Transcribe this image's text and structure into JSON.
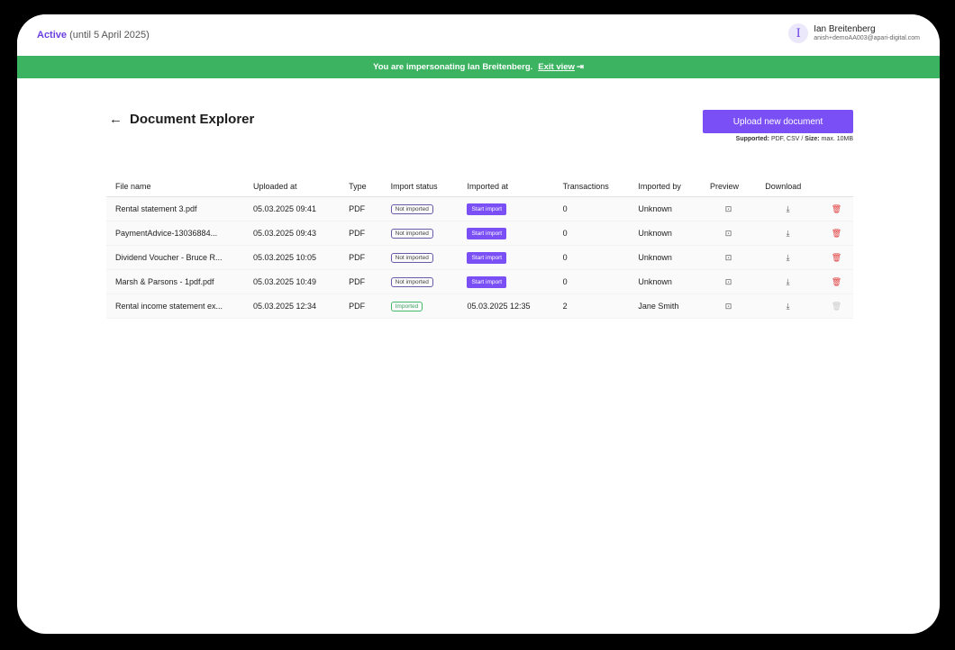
{
  "header": {
    "status_active": "Active",
    "status_rest": "(until 5 April 2025)",
    "user_initial": "I",
    "user_name": "Ian Breitenberg",
    "user_email": "anish+demoAA003@apari-digital.com"
  },
  "banner": {
    "text": "You are impersonating Ian Breitenberg.",
    "exit_label": "Exit view",
    "exit_icon": "⇥"
  },
  "page": {
    "back_icon": "←",
    "title": "Document Explorer",
    "upload_label": "Upload new document",
    "supported_label": "Supported:",
    "supported_types": "PDF, CSV /",
    "size_label": "Size:",
    "size_value": "max. 10MB"
  },
  "table": {
    "headers": [
      "File name",
      "Uploaded at",
      "Type",
      "Import status",
      "Imported at",
      "Transactions",
      "Imported by",
      "Preview",
      "Download"
    ],
    "start_import_label": "Start import",
    "preview_icon": "⊡",
    "download_icon": "⤓",
    "delete_icon": "🗑",
    "rows": [
      {
        "file": "Rental statement 3.pdf",
        "uploaded": "05.03.2025 09:41",
        "type": "PDF",
        "status": "Not imported",
        "imported_at": "",
        "transactions": "0",
        "imported_by": "Unknown"
      },
      {
        "file": "PaymentAdvice-13036884...",
        "uploaded": "05.03.2025 09:43",
        "type": "PDF",
        "status": "Not imported",
        "imported_at": "",
        "transactions": "0",
        "imported_by": "Unknown"
      },
      {
        "file": "Dividend Voucher - Bruce R...",
        "uploaded": "05.03.2025 10:05",
        "type": "PDF",
        "status": "Not imported",
        "imported_at": "",
        "transactions": "0",
        "imported_by": "Unknown"
      },
      {
        "file": "Marsh & Parsons - 1pdf.pdf",
        "uploaded": "05.03.2025 10:49",
        "type": "PDF",
        "status": "Not imported",
        "imported_at": "",
        "transactions": "0",
        "imported_by": "Unknown"
      },
      {
        "file": "Rental income statement ex...",
        "uploaded": "05.03.2025 12:34",
        "type": "PDF",
        "status": "Imported",
        "imported_at": "05.03.2025 12:35",
        "transactions": "2",
        "imported_by": "Jane Smith"
      }
    ]
  }
}
